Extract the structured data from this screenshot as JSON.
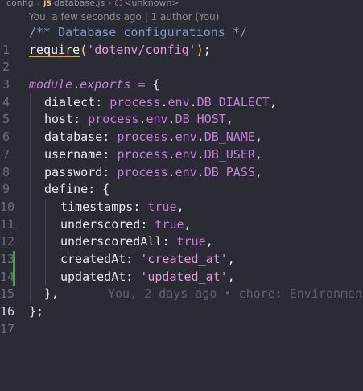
{
  "breadcrumb": {
    "folder": "config",
    "file": "database.js",
    "symbol": "<unknown>",
    "js_badge": "JS"
  },
  "codelens": "You, a few seconds ago | 1 author (You)",
  "lines": [
    {
      "num": "1",
      "comment": "/** Database configurations */"
    },
    {
      "num": "2",
      "fn": "require",
      "open": "(",
      "str": "'dotenv/config'",
      "close": ")",
      "end": ";"
    },
    {
      "num": "3"
    },
    {
      "num": "4",
      "obj": "module",
      "dot": ".",
      "prop": "exports",
      "op": " = ",
      "brace": "{"
    },
    {
      "num": "5",
      "key": "dialect",
      "colon": ": ",
      "proc": "process",
      "d1": ".",
      "env": "env",
      "d2": ".",
      "const": "DB_DIALECT",
      "comma": ","
    },
    {
      "num": "6",
      "key": "host",
      "colon": ": ",
      "proc": "process",
      "d1": ".",
      "env": "env",
      "d2": ".",
      "const": "DB_HOST",
      "comma": ","
    },
    {
      "num": "7",
      "key": "database",
      "colon": ": ",
      "proc": "process",
      "d1": ".",
      "env": "env",
      "d2": ".",
      "const": "DB_NAME",
      "comma": ","
    },
    {
      "num": "8",
      "key": "username",
      "colon": ": ",
      "proc": "process",
      "d1": ".",
      "env": "env",
      "d2": ".",
      "const": "DB_USER",
      "comma": ","
    },
    {
      "num": "9",
      "key": "password",
      "colon": ": ",
      "proc": "process",
      "d1": ".",
      "env": "env",
      "d2": ".",
      "const": "DB_PASS",
      "comma": ","
    },
    {
      "num": "10",
      "key": "define",
      "colon": ": ",
      "brace": "{"
    },
    {
      "num": "11",
      "key": "timestamps",
      "colon": ": ",
      "bool": "true",
      "comma": ","
    },
    {
      "num": "12",
      "key": "underscored",
      "colon": ": ",
      "bool": "true",
      "comma": ","
    },
    {
      "num": "13",
      "key": "underscoredAll",
      "colon": ": ",
      "bool": "true",
      "comma": ","
    },
    {
      "num": "14",
      "key": "createdAt",
      "colon": ": ",
      "str": "'created_at'",
      "comma": ","
    },
    {
      "num": "15",
      "key": "updatedAt",
      "colon": ": ",
      "str": "'updated_at'",
      "comma": ","
    },
    {
      "num": "16",
      "brace": "}",
      "comma": ","
    },
    {
      "num": "17",
      "brace": "}",
      "end": ";"
    }
  ],
  "blame": "You, 2 days ago • chore: Environment",
  "colors": {
    "background": "#2b2b35",
    "git_added": "#4f9a54",
    "keyword_purple": "#c57fd8",
    "string_pink": "#e29ad9",
    "comment_blue": "#7e9bc4"
  }
}
